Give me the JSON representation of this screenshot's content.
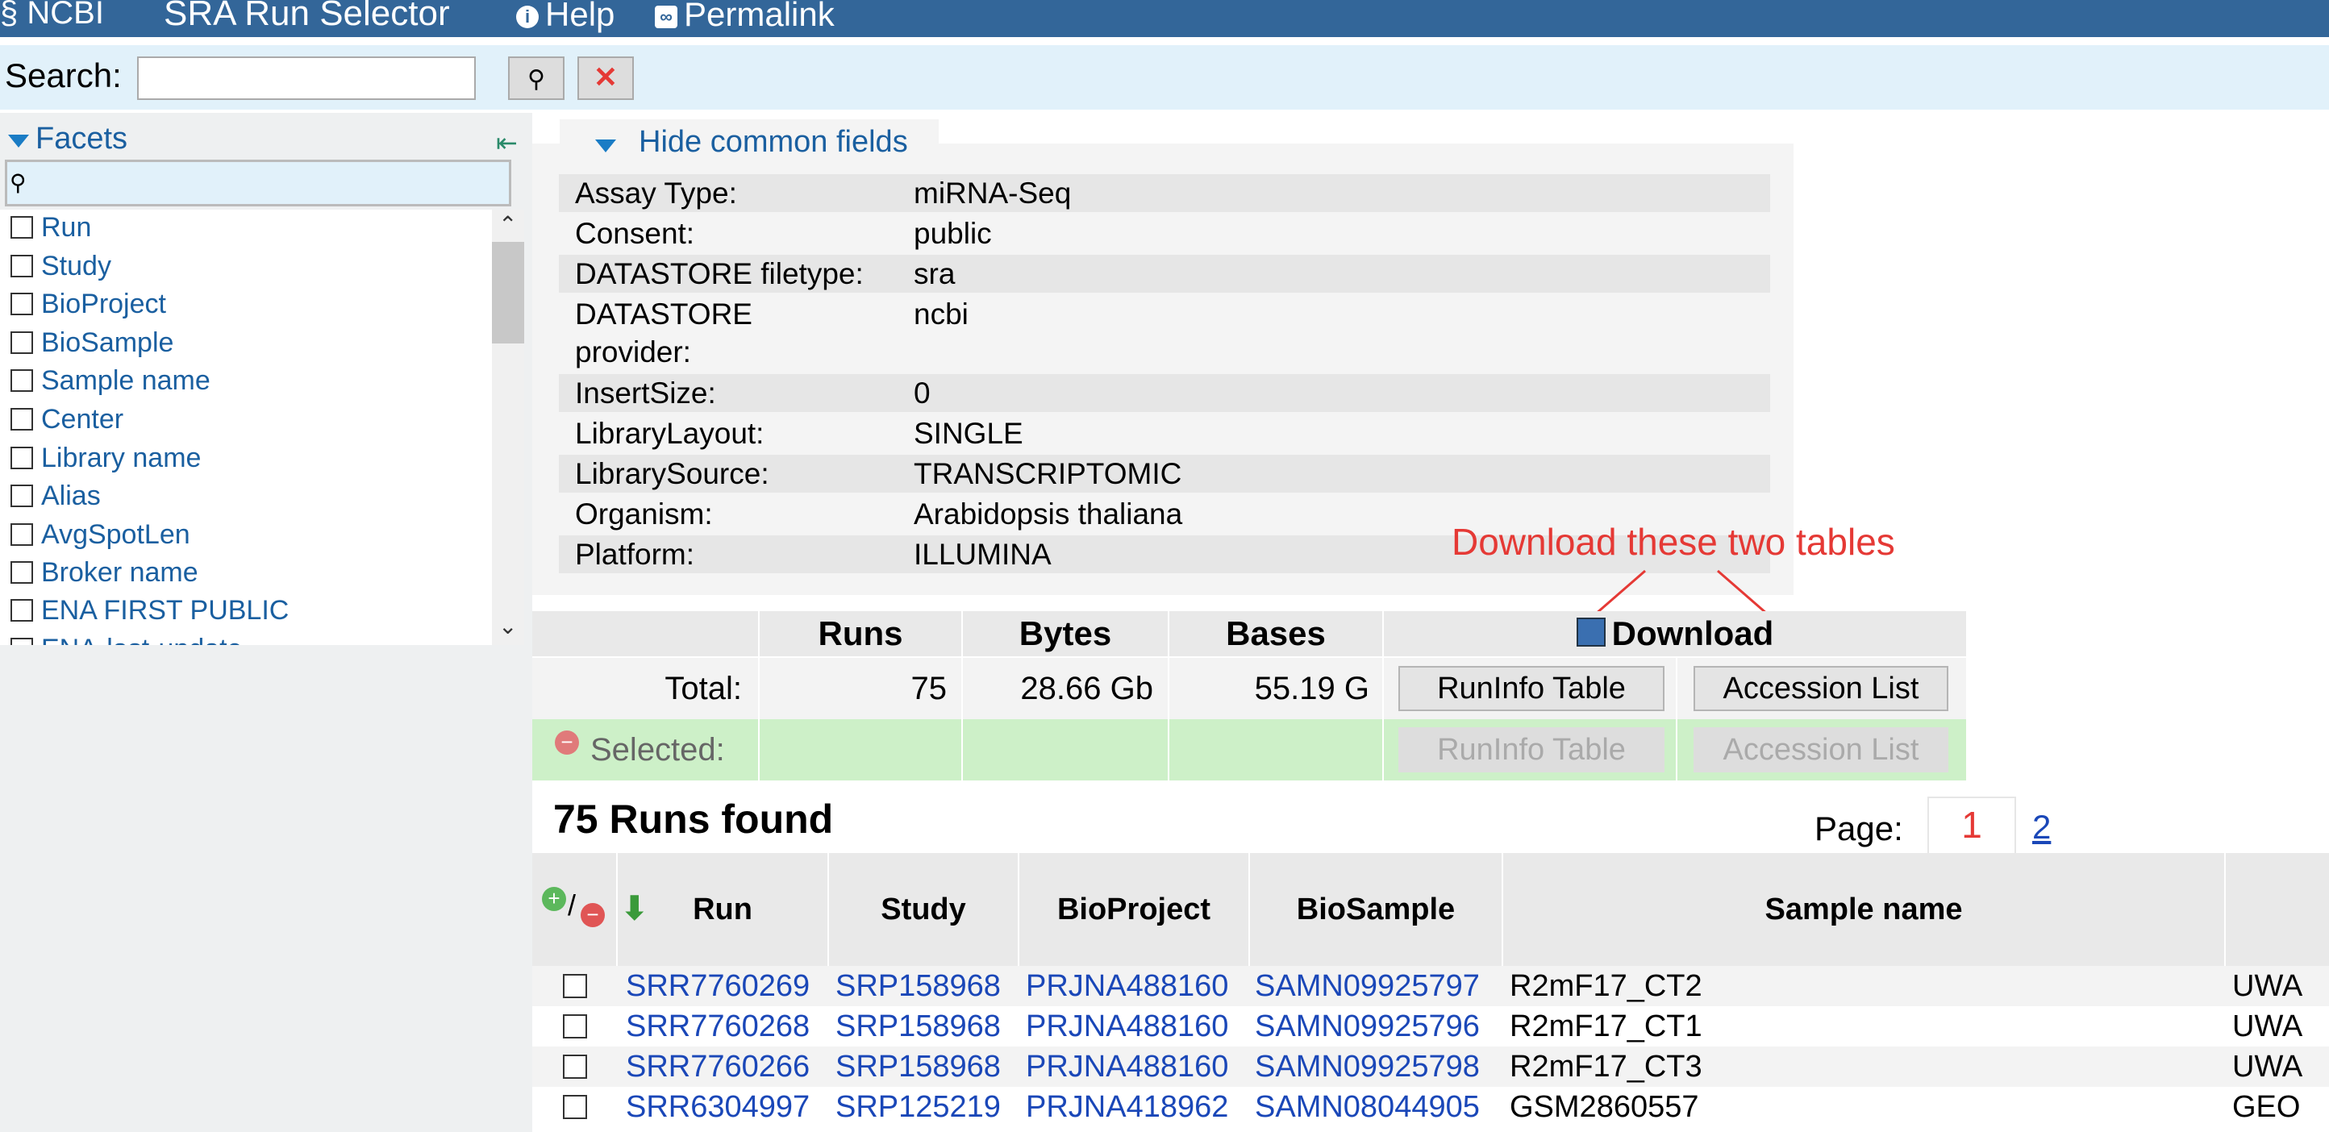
{
  "header": {
    "logo": "NCBI",
    "title": "SRA Run Selector",
    "help": "Help",
    "permalink": "Permalink"
  },
  "search": {
    "label": "Search:",
    "value": "",
    "placeholder": ""
  },
  "facets": {
    "title": "Facets",
    "items": [
      {
        "label": "Run"
      },
      {
        "label": "Study"
      },
      {
        "label": "BioProject"
      },
      {
        "label": "BioSample"
      },
      {
        "label": "Sample name"
      },
      {
        "label": "Center"
      },
      {
        "label": "Library name"
      },
      {
        "label": "Alias"
      },
      {
        "label": "AvgSpotLen"
      },
      {
        "label": "Broker name"
      },
      {
        "label": "ENA FIRST PUBLIC"
      },
      {
        "label": "ENA-last-update"
      }
    ]
  },
  "common_fields": {
    "toggle_label": "Hide common fields",
    "rows": [
      {
        "key": "Assay Type:",
        "value": "miRNA-Seq"
      },
      {
        "key": "Consent:",
        "value": "public"
      },
      {
        "key": "DATASTORE filetype:",
        "value": "sra"
      },
      {
        "key": "DATASTORE provider:",
        "value": "ncbi"
      },
      {
        "key": "InsertSize:",
        "value": "0"
      },
      {
        "key": "LibraryLayout:",
        "value": "SINGLE"
      },
      {
        "key": "LibrarySource:",
        "value": "TRANSCRIPTOMIC"
      },
      {
        "key": "Organism:",
        "value": "Arabidopsis thaliana"
      },
      {
        "key": "Platform:",
        "value": "ILLUMINA"
      }
    ]
  },
  "annotation": {
    "text": "Download these two tables",
    "color": "#e53935"
  },
  "totals": {
    "headers": {
      "runs": "Runs",
      "bytes": "Bytes",
      "bases": "Bases",
      "download": "Download"
    },
    "total_label": "Total:",
    "runs": "75",
    "bytes": "28.66 Gb",
    "bases": "55.19 G",
    "runinfo_button": "RunInfo Table",
    "accession_button": "Accession List",
    "selected_label": "Selected:",
    "selected_runinfo_button": "RunInfo Table",
    "selected_accession_button": "Accession List"
  },
  "results": {
    "found_label": "75 Runs found",
    "page_label": "Page:",
    "current_page": "1",
    "next_page": "2",
    "columns": [
      "Run",
      "Study",
      "BioProject",
      "BioSample",
      "Sample name"
    ],
    "rows": [
      {
        "run": "SRR7760269",
        "study": "SRP158968",
        "bioproject": "PRJNA488160",
        "biosample": "SAMN09925797",
        "sample_name": "R2mF17_CT2",
        "center": "UWA"
      },
      {
        "run": "SRR7760268",
        "study": "SRP158968",
        "bioproject": "PRJNA488160",
        "biosample": "SAMN09925796",
        "sample_name": "R2mF17_CT1",
        "center": "UWA"
      },
      {
        "run": "SRR7760266",
        "study": "SRP158968",
        "bioproject": "PRJNA488160",
        "biosample": "SAMN09925798",
        "sample_name": "R2mF17_CT3",
        "center": "UWA"
      },
      {
        "run": "SRR6304997",
        "study": "SRP125219",
        "bioproject": "PRJNA418962",
        "biosample": "SAMN08044905",
        "sample_name": "GSM2860557",
        "center": "GEO"
      }
    ]
  }
}
